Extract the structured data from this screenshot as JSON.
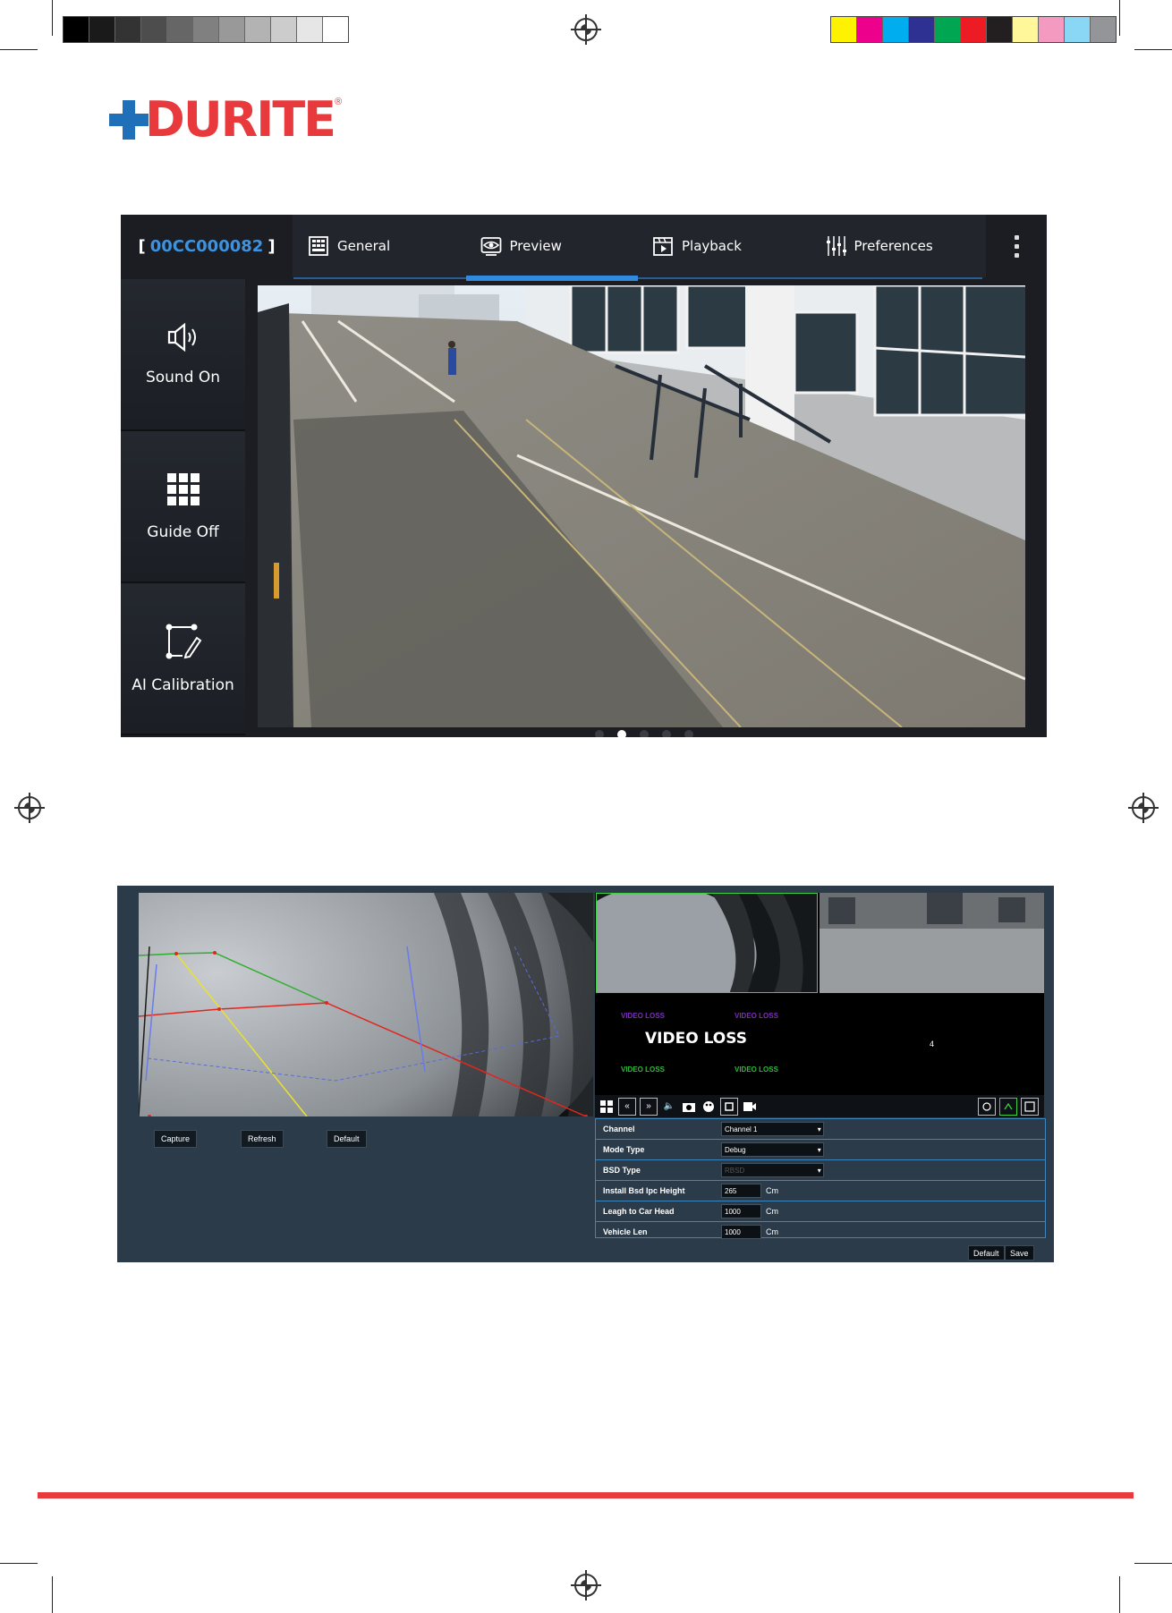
{
  "brand": {
    "name": "DURITE",
    "registered": "®"
  },
  "app": {
    "device_open": "[",
    "device_id": "00CC000082",
    "device_close": "]",
    "tabs": [
      {
        "label": "General",
        "icon": "grid-panel-icon"
      },
      {
        "label": "Preview",
        "icon": "eye-icon",
        "active": true
      },
      {
        "label": "Playback",
        "icon": "film-play-icon"
      },
      {
        "label": "Preferences",
        "icon": "sliders-icon"
      }
    ],
    "more_icon": "kebab-menu-icon",
    "side_buttons": [
      {
        "label": "Sound On",
        "icon": "speaker-icon"
      },
      {
        "label": "Guide Off",
        "icon": "grid-3x3-icon"
      },
      {
        "label": "AI Calibration",
        "icon": "calibration-pen-icon"
      }
    ],
    "pager": {
      "pages": 5,
      "active_index": 1
    }
  },
  "web": {
    "calibration_buttons": [
      "Capture",
      "Refresh",
      "Default"
    ],
    "grid_cells": {
      "cell3_big": "VIDEO LOSS",
      "cell3_small": "VIDEO LOSS",
      "cell4": "4"
    },
    "form": [
      {
        "label": "Channel",
        "type": "select",
        "value": "Channel 1"
      },
      {
        "label": "Mode Type",
        "type": "select",
        "value": "Debug"
      },
      {
        "label": "BSD Type",
        "type": "select",
        "value": "RBSD",
        "disabled": true
      },
      {
        "label": "Install Bsd Ipc Height",
        "type": "input",
        "value": "265",
        "unit": "Cm"
      },
      {
        "label": "Leagh to Car Head",
        "type": "input",
        "value": "1000",
        "unit": "Cm"
      },
      {
        "label": "Vehicle Len",
        "type": "input",
        "value": "1000",
        "unit": "Cm"
      }
    ],
    "form_buttons": {
      "default": "Default",
      "save": "Save"
    }
  },
  "colors": {
    "brand_red": "#e8393c",
    "brand_blue": "#1f70b8",
    "accent_blue": "#2f8ae0",
    "device_id_blue": "#3d93e0"
  },
  "print_marks": {
    "grayscale": [
      "#000000",
      "#1a1a1a",
      "#333333",
      "#4d4d4d",
      "#666666",
      "#808080",
      "#999999",
      "#b3b3b3",
      "#cccccc",
      "#e6e6e6",
      "#ffffff"
    ],
    "colors": [
      "#fff200",
      "#ec008c",
      "#00aeef",
      "#2e3192",
      "#00a651",
      "#ed1c24",
      "#231f20",
      "#fff799",
      "#f49ac1",
      "#8ad6f5",
      "#939598"
    ]
  }
}
